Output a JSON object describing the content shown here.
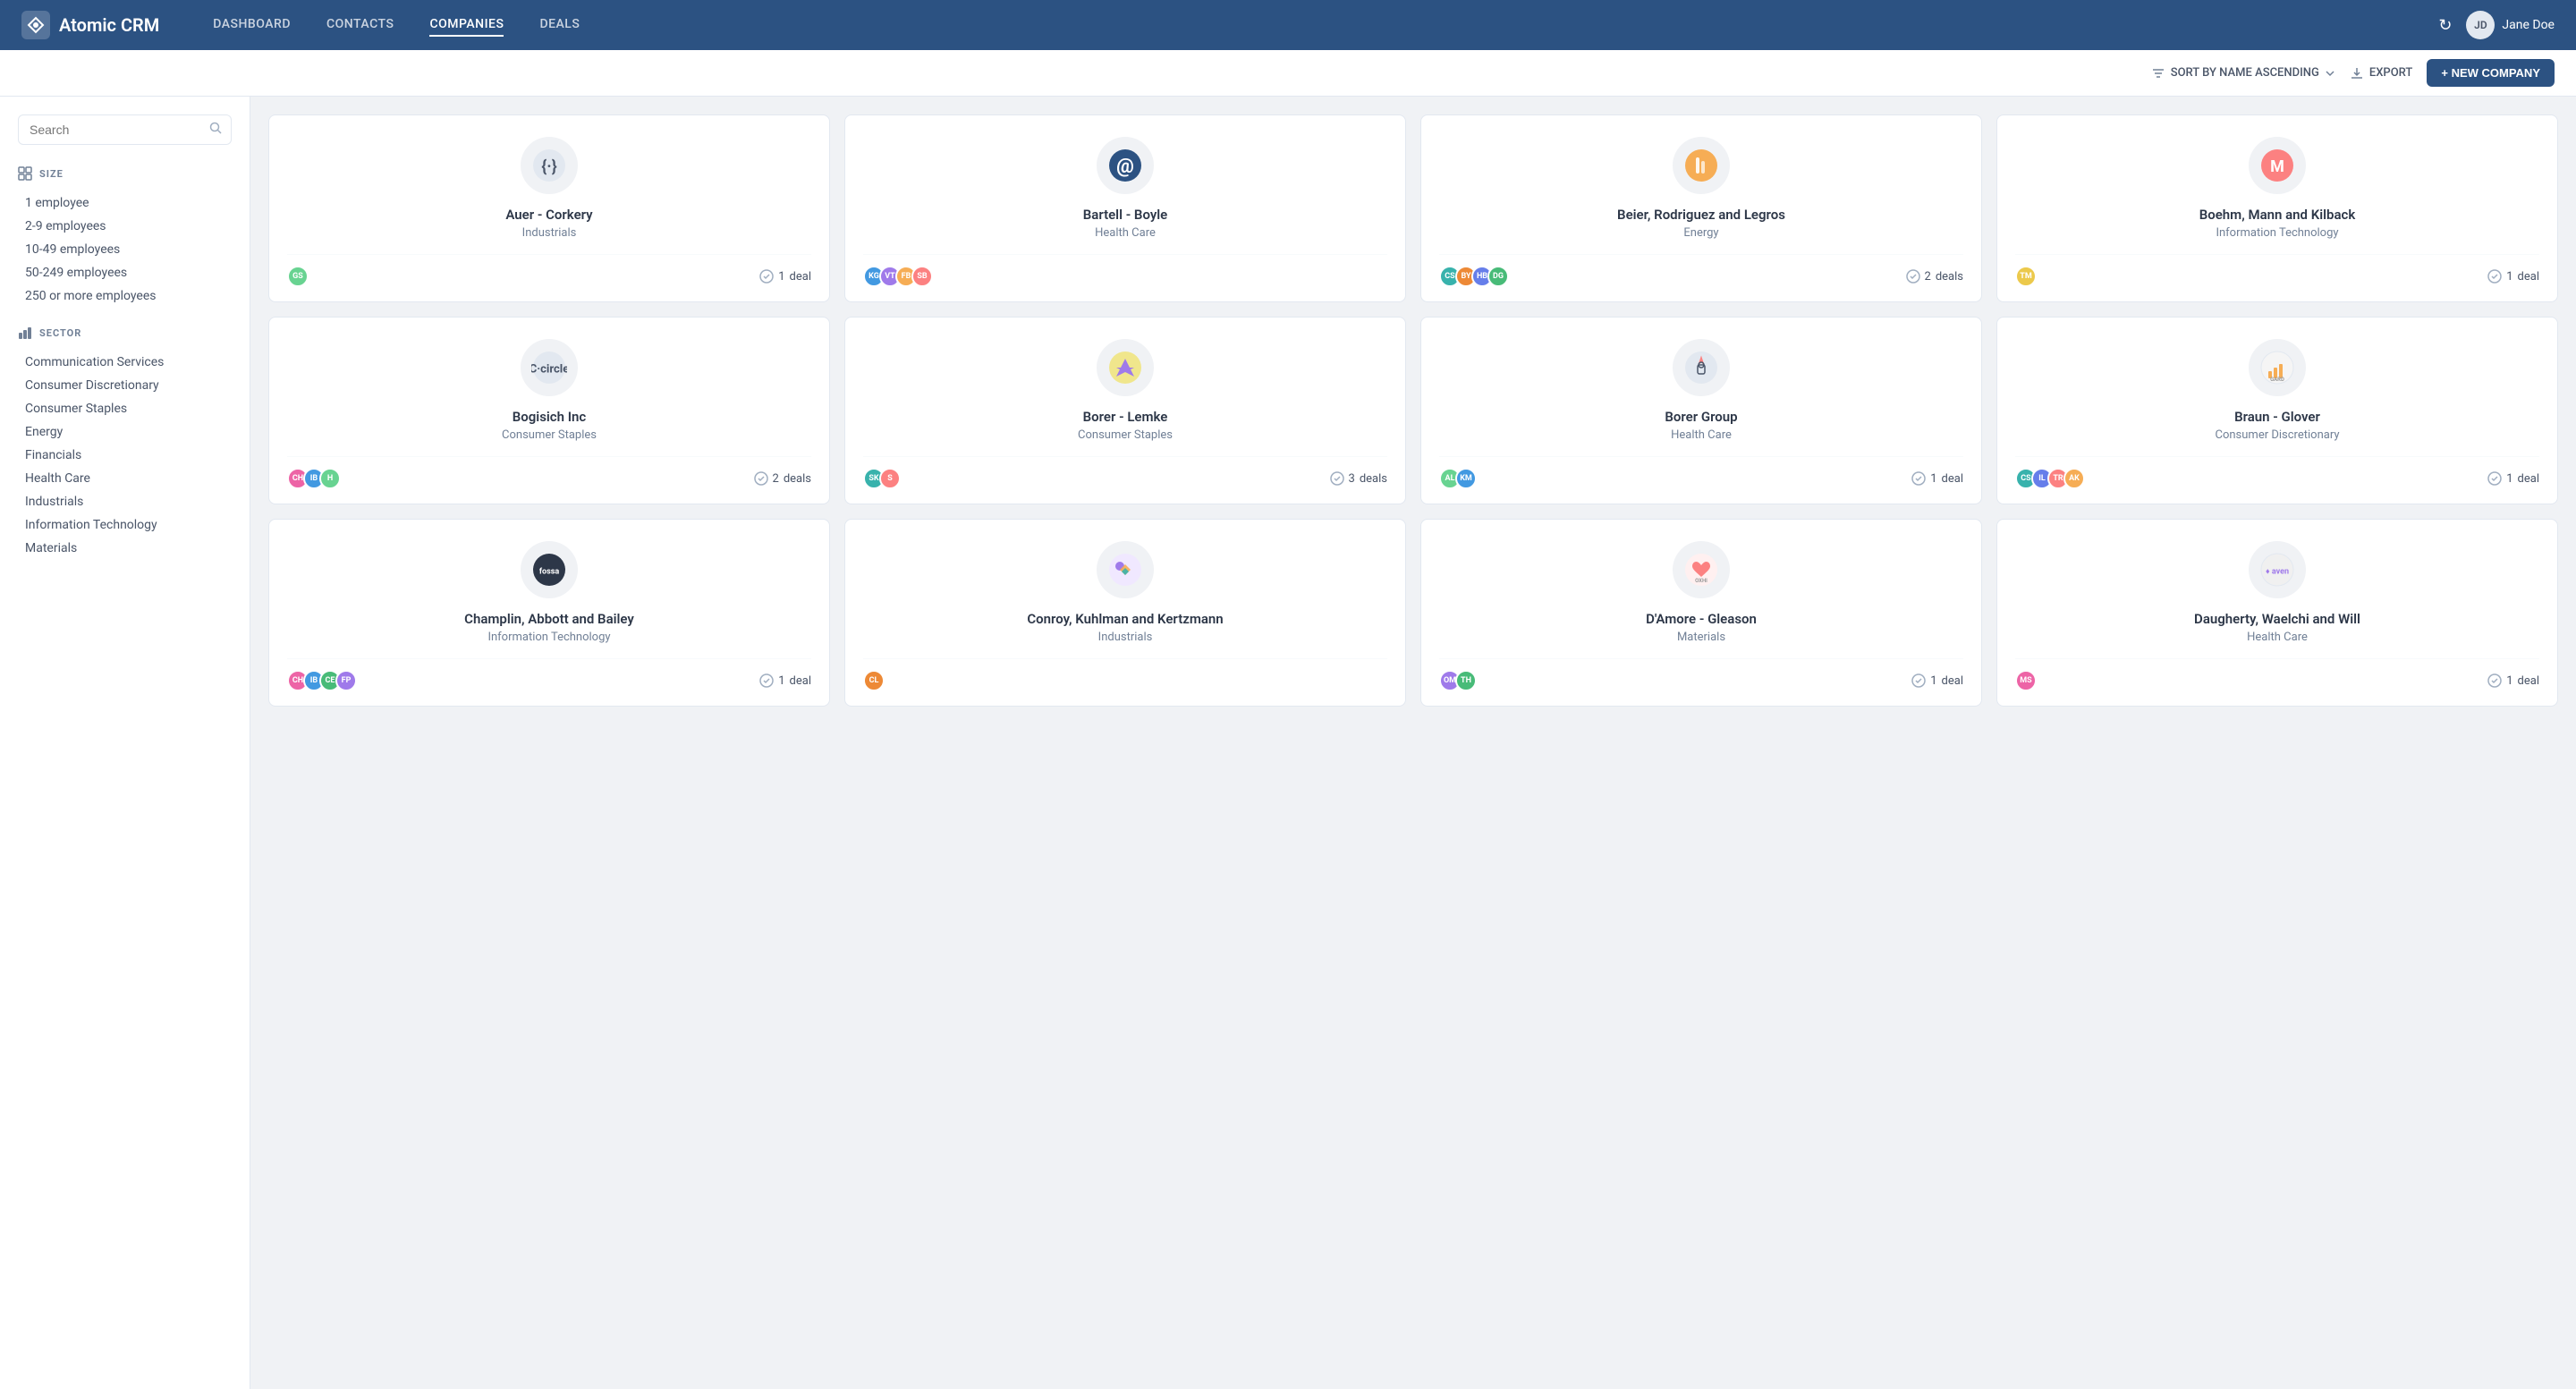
{
  "app": {
    "name": "Atomic CRM"
  },
  "nav": {
    "items": [
      {
        "id": "dashboard",
        "label": "DASHBOARD",
        "active": false
      },
      {
        "id": "contacts",
        "label": "CONTACTS",
        "active": false
      },
      {
        "id": "companies",
        "label": "COMPANIES",
        "active": true
      },
      {
        "id": "deals",
        "label": "DEALS",
        "active": false
      }
    ]
  },
  "toolbar": {
    "sort_label": "SORT BY NAME ASCENDING",
    "export_label": "EXPORT",
    "new_company_label": "+ NEW COMPANY"
  },
  "sidebar": {
    "search_placeholder": "Search",
    "size_label": "SIZE",
    "size_items": [
      "1 employee",
      "2-9 employees",
      "10-49 employees",
      "50-249 employees",
      "250 or more employees"
    ],
    "sector_label": "SECTOR",
    "sector_items": [
      "Communication Services",
      "Consumer Discretionary",
      "Consumer Staples",
      "Energy",
      "Financials",
      "Health Care",
      "Industrials",
      "Information Technology",
      "Materials"
    ]
  },
  "companies": [
    {
      "name": "Auer - Corkery",
      "sector": "Industrials",
      "logo_text": "{:}",
      "logo_bg": "#e2e8f0",
      "logo_color": "#4a5568",
      "avatars": [
        {
          "initials": "GS",
          "class": "av-gs"
        }
      ],
      "deals_count": "1",
      "deals_label": "deal"
    },
    {
      "name": "Bartell - Boyle",
      "sector": "Health Care",
      "logo_text": "@",
      "logo_bg": "#2c5282",
      "logo_color": "white",
      "avatars": [
        {
          "initials": "KG",
          "class": "av-kg"
        },
        {
          "initials": "VT",
          "class": "av-vt"
        },
        {
          "initials": "FB",
          "class": "av-fb"
        },
        {
          "initials": "SB",
          "class": "av-sb"
        }
      ],
      "deals_count": "",
      "deals_label": ""
    },
    {
      "name": "Beier, Rodriguez and Legros",
      "sector": "Energy",
      "logo_text": "▐",
      "logo_bg": "#f6ad55",
      "logo_color": "white",
      "avatars": [
        {
          "initials": "CS",
          "class": "av-cs"
        },
        {
          "initials": "BY",
          "class": "av-by"
        },
        {
          "initials": "HB",
          "class": "av-hb"
        },
        {
          "initials": "DG",
          "class": "av-dg"
        }
      ],
      "deals_count": "2",
      "deals_label": "deals"
    },
    {
      "name": "Boehm, Mann and Kilback",
      "sector": "Information Technology",
      "logo_text": "M",
      "logo_bg": "#fc8181",
      "logo_color": "white",
      "avatars": [
        {
          "initials": "TM",
          "class": "av-tm"
        }
      ],
      "deals_count": "1",
      "deals_label": "deal"
    },
    {
      "name": "Bogisich Inc",
      "sector": "Consumer Staples",
      "logo_text": "C",
      "logo_bg": "#e2e8f0",
      "logo_color": "#4a5568",
      "avatars": [
        {
          "initials": "CH",
          "class": "av-ch"
        },
        {
          "initials": "IB",
          "class": "av-ib"
        },
        {
          "initials": "H",
          "class": "av-gs"
        }
      ],
      "deals_count": "2",
      "deals_label": "deals"
    },
    {
      "name": "Borer - Lemke",
      "sector": "Consumer Staples",
      "logo_text": "◑",
      "logo_bg": "#f6ad55",
      "logo_color": "white",
      "avatars": [
        {
          "initials": "SK",
          "class": "av-sk"
        },
        {
          "initials": "S",
          "class": "av-red"
        }
      ],
      "deals_count": "3",
      "deals_label": "deals"
    },
    {
      "name": "Borer Group",
      "sector": "Health Care",
      "logo_text": "⚗",
      "logo_bg": "#e2e8f0",
      "logo_color": "#4a5568",
      "avatars": [
        {
          "initials": "AL",
          "class": "av-al"
        },
        {
          "initials": "KM",
          "class": "av-km"
        }
      ],
      "deals_count": "1",
      "deals_label": "deal"
    },
    {
      "name": "Braun - Glover",
      "sector": "Consumer Discretionary",
      "logo_text": "▌▌▌",
      "logo_bg": "#e2e8f0",
      "logo_color": "#f6ad55",
      "avatars": [
        {
          "initials": "CS",
          "class": "av-cs"
        },
        {
          "initials": "IL",
          "class": "av-il"
        },
        {
          "initials": "TR",
          "class": "av-tr"
        },
        {
          "initials": "AK",
          "class": "av-ak"
        }
      ],
      "deals_count": "1",
      "deals_label": "deal"
    },
    {
      "name": "Champlin, Abbott and Bailey",
      "sector": "Information Technology",
      "logo_text": "fossa",
      "logo_bg": "#2d3748",
      "logo_color": "white",
      "avatars": [
        {
          "initials": "CH",
          "class": "av-ch"
        },
        {
          "initials": "IB",
          "class": "av-ib"
        },
        {
          "initials": "CE",
          "class": "av-ce"
        },
        {
          "initials": "FP",
          "class": "av-fp"
        }
      ],
      "deals_count": "1",
      "deals_label": "deal"
    },
    {
      "name": "Conroy, Kuhlman and Kertzmann",
      "sector": "Industrials",
      "logo_text": "✦",
      "logo_bg": "#9f7aea",
      "logo_color": "white",
      "avatars": [
        {
          "initials": "CL",
          "class": "av-cl"
        }
      ],
      "deals_count": "",
      "deals_label": ""
    },
    {
      "name": "D'Amore - Gleason",
      "sector": "Materials",
      "logo_text": "♥",
      "logo_bg": "#fc8181",
      "logo_color": "white",
      "avatars": [
        {
          "initials": "OM",
          "class": "av-om"
        },
        {
          "initials": "TH",
          "class": "av-th"
        }
      ],
      "deals_count": "1",
      "deals_label": "deal"
    },
    {
      "name": "Daugherty, Waelchi and Will",
      "sector": "Health Care",
      "logo_text": "aven",
      "logo_bg": "#e2e8f0",
      "logo_color": "#4a5568",
      "avatars": [
        {
          "initials": "MS",
          "class": "av-ms"
        }
      ],
      "deals_count": "1",
      "deals_label": "deal"
    }
  ],
  "user": {
    "name": "Jane Doe",
    "initials": "JD"
  }
}
